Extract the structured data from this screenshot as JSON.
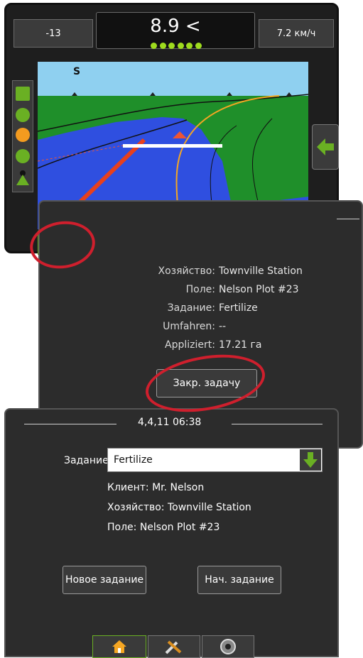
{
  "top_display": {
    "cross_track": "-13",
    "distance": "8.9 <",
    "speed": "7.2 км/ч",
    "heading": "S",
    "tabs": [
      "home-icon",
      "tools-icon",
      "guidance-icon",
      "field-icon",
      "camera-icon"
    ],
    "back_icon": "arrow-left-icon"
  },
  "job_summary": {
    "rows": [
      {
        "label": "Хозяйство:",
        "value": "Townville Station"
      },
      {
        "label": "Поле:",
        "value": "Nelson Plot #23"
      },
      {
        "label": "Задание:",
        "value": "Fertilize"
      },
      {
        "label": "Umfahren:",
        "value": "--"
      },
      {
        "label": "Appliziert:",
        "value": "17.21 га"
      }
    ],
    "close_button": "Закр. задачу"
  },
  "job_start": {
    "date": "4,4,11 06:38",
    "job_label": "Задание",
    "job_value": "Fertilize",
    "client": "Клиент: Mr. Nelson",
    "farm": "Хозяйство: Townville Station",
    "field": "Поле: Nelson Plot #23",
    "new_job_button": "Новое задание",
    "start_job_button": "Нач. задание",
    "tabs": [
      "home-icon",
      "tools-icon",
      "camera-icon"
    ]
  },
  "colors": {
    "highlight_ring": "#cf1f2d",
    "accent_green": "#6ab023",
    "field_green": "#1f8f2a",
    "coverage_blue": "#2f4fe0"
  }
}
